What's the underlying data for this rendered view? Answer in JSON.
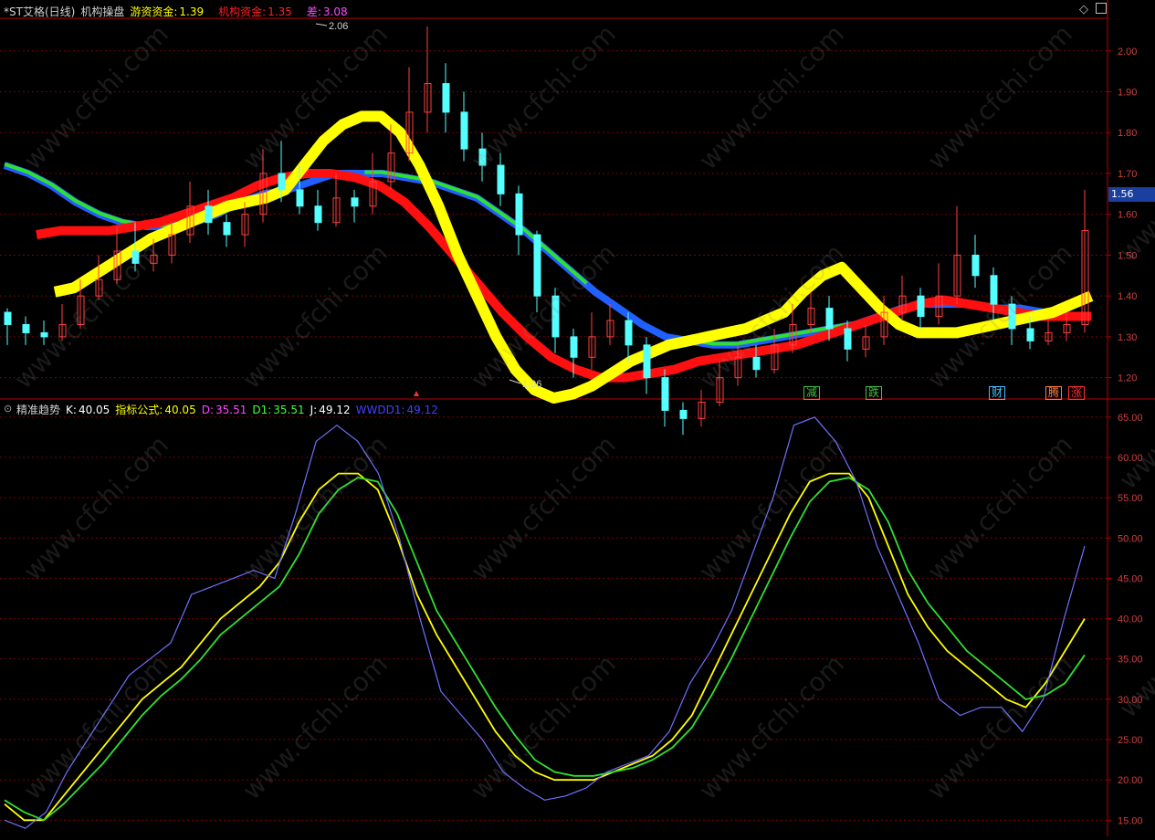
{
  "top_panel": {
    "title": "*ST艾格(日线)",
    "indicator_name": "机构操盘",
    "fields": [
      {
        "label": "游资资金:",
        "value": "1.39",
        "color": "#ffff00"
      },
      {
        "label": "机构资金:",
        "value": "1.35",
        "color": "#ff2020"
      },
      {
        "label": "差:",
        "value": "3.08",
        "color": "#ff44ff"
      }
    ],
    "price_tag": "1.56",
    "high_label": "2.06",
    "low_label": "1.06",
    "y_ticks": [
      "2.00",
      "1.90",
      "1.80",
      "1.70",
      "1.60",
      "1.50",
      "1.40",
      "1.30",
      "1.20"
    ],
    "signals": [
      {
        "text": "减",
        "color": "#40c040"
      },
      {
        "text": "跌",
        "color": "#40c040"
      },
      {
        "text": "财",
        "color": "#40c0ff"
      },
      {
        "text": "腾",
        "color": "#ff8040"
      },
      {
        "text": "涨",
        "color": "#ff3030"
      }
    ],
    "corner_icons": [
      "diamond-icon",
      "maximize-icon"
    ]
  },
  "bottom_panel": {
    "title": "精准趋势",
    "fields": [
      {
        "label": "K:",
        "value": "40.05",
        "color": "#ffffff"
      },
      {
        "label": "指标公式:",
        "value": "40.05",
        "color": "#ffff00"
      },
      {
        "label": "D:",
        "value": "35.51",
        "color": "#ff44ff"
      },
      {
        "label": "D1:",
        "value": "35.51",
        "color": "#40ff40"
      },
      {
        "label": "J:",
        "value": "49.12",
        "color": "#ffffff"
      },
      {
        "label": "WWDD1:",
        "value": "49.12",
        "color": "#4040ff"
      }
    ],
    "y_ticks": [
      "65.00",
      "60.00",
      "55.00",
      "50.00",
      "45.00",
      "40.00",
      "35.00",
      "30.00",
      "25.00",
      "20.00",
      "15.00"
    ]
  },
  "watermark": "www.cfchi.com",
  "colors": {
    "up": "#ff4040",
    "down": "#54ffff",
    "grid": "#800000",
    "axis": "#c00000"
  },
  "chart_data": [
    {
      "type": "candlestick",
      "title": "*ST艾格(日线)",
      "ylim": [
        1.15,
        2.08
      ],
      "x_count": 60,
      "candles": [
        [
          1.36,
          1.33,
          1.37,
          1.28
        ],
        [
          1.33,
          1.31,
          1.35,
          1.28
        ],
        [
          1.31,
          1.3,
          1.34,
          1.28
        ],
        [
          1.3,
          1.33,
          1.38,
          1.29
        ],
        [
          1.33,
          1.4,
          1.44,
          1.32
        ],
        [
          1.4,
          1.44,
          1.5,
          1.39
        ],
        [
          1.44,
          1.51,
          1.57,
          1.43
        ],
        [
          1.51,
          1.48,
          1.58,
          1.46
        ],
        [
          1.48,
          1.5,
          1.54,
          1.46
        ],
        [
          1.5,
          1.55,
          1.58,
          1.48
        ],
        [
          1.55,
          1.62,
          1.68,
          1.53
        ],
        [
          1.62,
          1.58,
          1.66,
          1.55
        ],
        [
          1.58,
          1.55,
          1.6,
          1.52
        ],
        [
          1.55,
          1.6,
          1.63,
          1.52
        ],
        [
          1.6,
          1.7,
          1.76,
          1.58
        ],
        [
          1.7,
          1.66,
          1.78,
          1.63
        ],
        [
          1.66,
          1.62,
          1.72,
          1.6
        ],
        [
          1.62,
          1.58,
          1.66,
          1.56
        ],
        [
          1.58,
          1.64,
          1.7,
          1.57
        ],
        [
          1.64,
          1.62,
          1.66,
          1.58
        ],
        [
          1.62,
          1.68,
          1.75,
          1.6
        ],
        [
          1.68,
          1.75,
          1.82,
          1.66
        ],
        [
          1.75,
          1.85,
          1.96,
          1.73
        ],
        [
          1.85,
          1.92,
          2.06,
          1.8
        ],
        [
          1.92,
          1.85,
          1.97,
          1.8
        ],
        [
          1.85,
          1.76,
          1.9,
          1.73
        ],
        [
          1.76,
          1.72,
          1.8,
          1.68
        ],
        [
          1.72,
          1.65,
          1.75,
          1.62
        ],
        [
          1.65,
          1.55,
          1.67,
          1.5
        ],
        [
          1.55,
          1.4,
          1.56,
          1.36
        ],
        [
          1.4,
          1.3,
          1.42,
          1.26
        ],
        [
          1.3,
          1.25,
          1.32,
          1.2
        ],
        [
          1.25,
          1.3,
          1.36,
          1.22
        ],
        [
          1.3,
          1.34,
          1.38,
          1.28
        ],
        [
          1.34,
          1.28,
          1.36,
          1.24
        ],
        [
          1.28,
          1.2,
          1.3,
          1.16
        ],
        [
          1.2,
          1.12,
          1.22,
          1.08
        ],
        [
          1.12,
          1.1,
          1.14,
          1.06
        ],
        [
          1.1,
          1.14,
          1.17,
          1.08
        ],
        [
          1.14,
          1.2,
          1.24,
          1.13
        ],
        [
          1.2,
          1.25,
          1.28,
          1.18
        ],
        [
          1.25,
          1.22,
          1.28,
          1.2
        ],
        [
          1.22,
          1.28,
          1.32,
          1.21
        ],
        [
          1.28,
          1.33,
          1.38,
          1.26
        ],
        [
          1.33,
          1.37,
          1.41,
          1.31
        ],
        [
          1.37,
          1.32,
          1.4,
          1.29
        ],
        [
          1.32,
          1.27,
          1.34,
          1.24
        ],
        [
          1.27,
          1.3,
          1.33,
          1.25
        ],
        [
          1.3,
          1.36,
          1.4,
          1.28
        ],
        [
          1.36,
          1.4,
          1.45,
          1.34
        ],
        [
          1.4,
          1.35,
          1.42,
          1.32
        ],
        [
          1.35,
          1.4,
          1.48,
          1.33
        ],
        [
          1.4,
          1.5,
          1.62,
          1.38
        ],
        [
          1.5,
          1.45,
          1.55,
          1.42
        ],
        [
          1.45,
          1.38,
          1.47,
          1.34
        ],
        [
          1.38,
          1.32,
          1.4,
          1.28
        ],
        [
          1.32,
          1.29,
          1.35,
          1.27
        ],
        [
          1.29,
          1.31,
          1.34,
          1.28
        ],
        [
          1.31,
          1.33,
          1.36,
          1.29
        ],
        [
          1.33,
          1.56,
          1.66,
          1.31
        ]
      ],
      "series": [
        {
          "name": "游资资金",
          "color": "#ffff00",
          "values": [
            1.41,
            1.42,
            1.45,
            1.48,
            1.51,
            1.54,
            1.56,
            1.58,
            1.6,
            1.62,
            1.63,
            1.64,
            1.66,
            1.72,
            1.78,
            1.82,
            1.84,
            1.84,
            1.8,
            1.72,
            1.62,
            1.5,
            1.4,
            1.3,
            1.22,
            1.17,
            1.15,
            1.16,
            1.18,
            1.21,
            1.24,
            1.26,
            1.28,
            1.29,
            1.3,
            1.31,
            1.32,
            1.34,
            1.36,
            1.41,
            1.45,
            1.47,
            1.42,
            1.37,
            1.33,
            1.31,
            1.31,
            1.31,
            1.32,
            1.33,
            1.34,
            1.35,
            1.36,
            1.38,
            1.4
          ]
        },
        {
          "name": "机构资金",
          "color": "#ff2020",
          "values": [
            1.55,
            1.56,
            1.56,
            1.56,
            1.57,
            1.58,
            1.6,
            1.62,
            1.64,
            1.67,
            1.69,
            1.7,
            1.7,
            1.69,
            1.67,
            1.63,
            1.57,
            1.5,
            1.43,
            1.36,
            1.3,
            1.25,
            1.22,
            1.2,
            1.2,
            1.21,
            1.22,
            1.24,
            1.25,
            1.26,
            1.27,
            1.28,
            1.3,
            1.32,
            1.34,
            1.36,
            1.38,
            1.39,
            1.38,
            1.37,
            1.36,
            1.35,
            1.35,
            1.35
          ]
        },
        {
          "name": "趋势线",
          "values": [
            1.72,
            1.7,
            1.67,
            1.63,
            1.6,
            1.58,
            1.57,
            1.57,
            1.58,
            1.6,
            1.63,
            1.65,
            1.66,
            1.68,
            1.7,
            1.7,
            1.7,
            1.69,
            1.68,
            1.66,
            1.64,
            1.6,
            1.56,
            1.51,
            1.46,
            1.41,
            1.37,
            1.33,
            1.3,
            1.29,
            1.28,
            1.28,
            1.29,
            1.3,
            1.31,
            1.32,
            1.33,
            1.35,
            1.37,
            1.38,
            1.38,
            1.38,
            1.37,
            1.37,
            1.36,
            1.35,
            1.35
          ]
        }
      ]
    },
    {
      "type": "line",
      "title": "精准趋势",
      "ylim": [
        13,
        66
      ],
      "series": [
        {
          "name": "K",
          "color": "#ffff00",
          "values": [
            17,
            15,
            15,
            18,
            21,
            24,
            27,
            30,
            32,
            34,
            37,
            40,
            42,
            44,
            47,
            52,
            56,
            58,
            58,
            56,
            50,
            43,
            38,
            34,
            30,
            26,
            23,
            21,
            20,
            20,
            20,
            21,
            22,
            23,
            25,
            28,
            33,
            38,
            43,
            48,
            53,
            57,
            58,
            58,
            55,
            49,
            43,
            39,
            36,
            34,
            32,
            30,
            29,
            32,
            36,
            40
          ]
        },
        {
          "name": "D",
          "color": "#40ff40",
          "values": [
            17.5,
            16,
            15,
            17,
            19.5,
            22,
            25,
            28,
            30.5,
            32.5,
            35,
            38,
            40,
            42,
            44,
            48,
            53,
            56,
            57.5,
            57,
            53,
            47,
            41,
            37,
            33,
            29,
            25.5,
            22.5,
            21,
            20.5,
            20.5,
            21,
            21.5,
            22.5,
            24,
            26.5,
            30.5,
            35,
            40,
            45,
            50,
            54.5,
            57,
            57.5,
            56,
            52,
            46,
            42,
            39,
            36,
            34,
            32,
            30,
            30.5,
            32,
            35.5
          ]
        },
        {
          "name": "J",
          "color": "#8080ff",
          "values": [
            15,
            14,
            16,
            21,
            25,
            29,
            33,
            35,
            37,
            43,
            44,
            45,
            46,
            45,
            53,
            62,
            64,
            62,
            58,
            50,
            40,
            31,
            28,
            25,
            21,
            19,
            17.5,
            18,
            19,
            21,
            22,
            23,
            26,
            32,
            36,
            41,
            48,
            55,
            64,
            65,
            62,
            57,
            49,
            43,
            37,
            30,
            28,
            29,
            29,
            26,
            30,
            40,
            49
          ]
        }
      ]
    }
  ]
}
